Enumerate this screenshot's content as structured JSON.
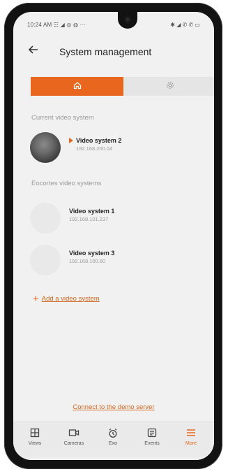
{
  "status_bar": {
    "time_and_icons": "10:24 AM ☷ ◢ ◎ ◍ ···",
    "right_icons": "✱ ◢ ✆ ✆ ▭"
  },
  "header": {
    "back_icon": "arrow-left-icon",
    "title": "System management"
  },
  "tabs": [
    {
      "icon": "home-icon",
      "active": true
    },
    {
      "icon": "settings-icon",
      "active": false
    }
  ],
  "current_section": {
    "label": "Current video system"
  },
  "current_system": {
    "name": "Video system 2",
    "ip": "192.168.200.04",
    "playing": true
  },
  "other_section": {
    "label": "Eocortes video systems"
  },
  "other_systems": [
    {
      "name": "Video system 1",
      "ip": "192.168.101.237"
    },
    {
      "name": "Video system 3",
      "ip": "192.168.100.60"
    }
  ],
  "add_link": {
    "label": "Add a video system"
  },
  "demo_link": {
    "label": "Connect to the demo server"
  },
  "bottom_nav": [
    {
      "label": "Views",
      "icon": "grid-icon",
      "active": false
    },
    {
      "label": "Cameras",
      "icon": "camera-icon",
      "active": false
    },
    {
      "label": "Exo",
      "icon": "alarm-clock-icon",
      "active": false
    },
    {
      "label": "Events",
      "icon": "events-icon",
      "active": false
    },
    {
      "label": "More",
      "icon": "menu-icon",
      "active": true
    }
  ],
  "system_nav": [
    "■",
    "◉",
    "◂"
  ],
  "colors": {
    "accent": "#e8661d",
    "background": "#f1f1f1",
    "link": "#d4671f"
  }
}
